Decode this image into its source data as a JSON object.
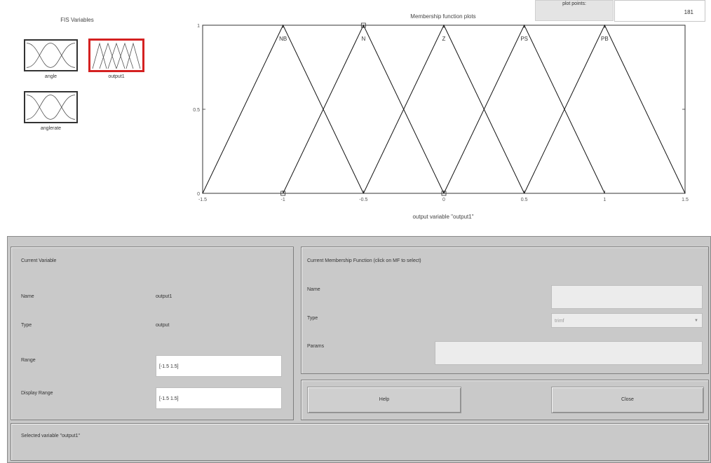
{
  "fis": {
    "title": "FIS Variables",
    "variables": [
      {
        "label": "angle",
        "selected": false
      },
      {
        "label": "output1",
        "selected": true
      },
      {
        "label": "anglerate",
        "selected": false
      }
    ]
  },
  "top_controls": {
    "plot_points_label": "plot points:",
    "plot_points_value": "181"
  },
  "chart_data": {
    "type": "line",
    "title": "Membership function plots",
    "xlabel": "output variable \"output1\"",
    "ylabel": "",
    "xlim": [
      -1.5,
      1.5
    ],
    "ylim": [
      0,
      1
    ],
    "x_ticks": [
      -1.5,
      -1,
      -0.5,
      0,
      0.5,
      1,
      1.5
    ],
    "x_tick_labels": [
      "-1.5",
      "-1",
      "-0.5",
      "0",
      "0.5",
      "1",
      "1.5"
    ],
    "y_ticks": [
      0,
      0.5,
      1
    ],
    "y_tick_labels": [
      "0",
      "0.5",
      "1"
    ],
    "series": [
      {
        "name": "NB",
        "x": [
          -1.5,
          -1,
          -0.5
        ],
        "y": [
          0,
          1,
          0
        ]
      },
      {
        "name": "N",
        "x": [
          -1,
          -0.5,
          0
        ],
        "y": [
          0,
          1,
          0
        ]
      },
      {
        "name": "Z",
        "x": [
          -0.5,
          0,
          0.5
        ],
        "y": [
          0,
          1,
          0
        ]
      },
      {
        "name": "PS",
        "x": [
          0,
          0.5,
          1
        ],
        "y": [
          0,
          1,
          0
        ]
      },
      {
        "name": "PB",
        "x": [
          0.5,
          1,
          1.5
        ],
        "y": [
          0,
          1,
          0
        ]
      }
    ]
  },
  "current_variable": {
    "title": "Current Variable",
    "name_label": "Name",
    "name_value": "output1",
    "type_label": "Type",
    "type_value": "output",
    "range_label": "Range",
    "range_value": "[-1.5 1.5]",
    "display_range_label": "Display Range",
    "display_range_value": "[-1.5 1.5]"
  },
  "current_mf": {
    "title": "Current Membership Function (click on MF to select)",
    "name_label": "Name",
    "name_value": "",
    "type_label": "Type",
    "type_value": "trimf",
    "params_label": "Params",
    "params_value": ""
  },
  "buttons": {
    "help": "Help",
    "close": "Close"
  },
  "status": {
    "text": "Selected variable \"output1\""
  }
}
